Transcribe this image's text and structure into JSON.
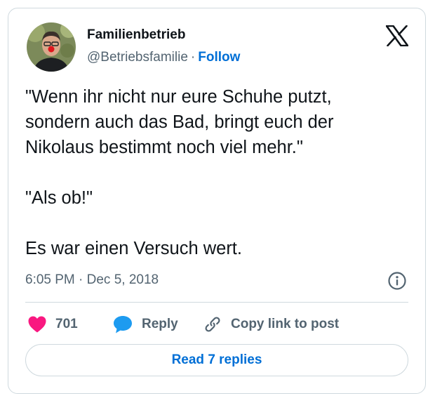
{
  "author": {
    "name": "Familienbetrieb",
    "handle": "@Betriebsfamilie",
    "separator": "·",
    "follow_label": "Follow"
  },
  "tweet": {
    "line1": "\"Wenn ihr nicht nur eure Schuhe putzt,",
    "line2": "sondern auch das Bad, bringt euch der",
    "line3": "Nikolaus bestimmt noch viel mehr.\"",
    "line4": "\"Als ob!\"",
    "line5": "Es war einen Versuch wert."
  },
  "meta": {
    "timestamp": "6:05 PM · Dec 5, 2018"
  },
  "actions": {
    "like_count": "701",
    "reply_label": "Reply",
    "copy_link_label": "Copy link to post"
  },
  "footer": {
    "read_replies_label": "Read 7 replies"
  },
  "icons": {
    "brand": "x-logo-icon",
    "info": "info-icon",
    "like": "heart-icon",
    "reply": "speech-bubble-icon",
    "copy": "link-icon"
  },
  "colors": {
    "text": "#0f1419",
    "secondary": "#536471",
    "link": "#006fd6",
    "like": "#f91880",
    "reply": "#1d9bf0",
    "border": "#cfd9de"
  }
}
